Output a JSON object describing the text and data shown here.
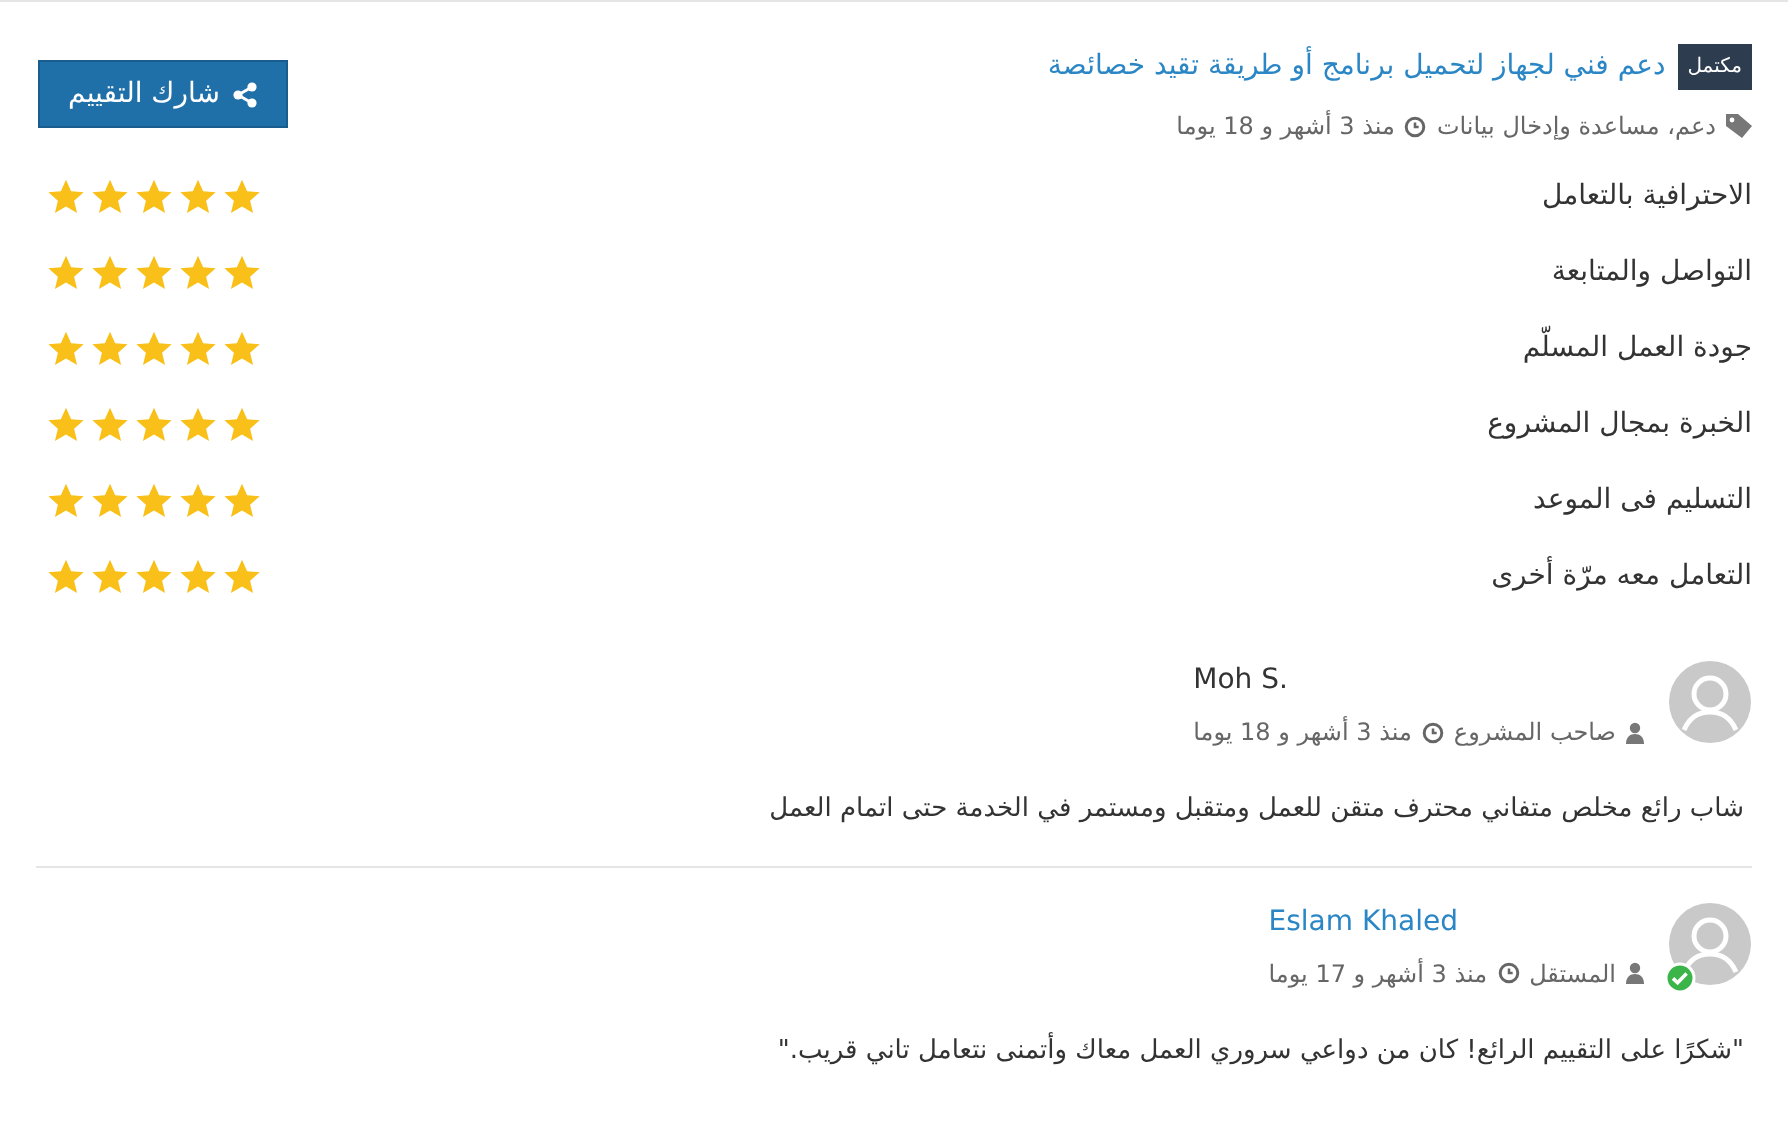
{
  "project": {
    "status_badge": "مكتمل",
    "title": "دعم فني لجهاز لتحميل برنامج أو طريقة تقيد خصائصة",
    "tags": "دعم، مساعدة وإدخال بيانات",
    "time": "منذ 3 أشهر و 18 يوما"
  },
  "share_button": "شارك التقييم",
  "ratings": [
    {
      "label": "الاحترافية بالتعامل",
      "stars": 5
    },
    {
      "label": "التواصل والمتابعة",
      "stars": 5
    },
    {
      "label": "جودة العمل المسلّم",
      "stars": 5
    },
    {
      "label": "الخبرة بمجال المشروع",
      "stars": 5
    },
    {
      "label": "التسليم فى الموعد",
      "stars": 5
    },
    {
      "label": "التعامل معه مرّة أخرى",
      "stars": 5
    }
  ],
  "comments": [
    {
      "name": "Moh S.",
      "role": "صاحب المشروع",
      "time": "منذ 3 أشهر و 18 يوما",
      "text": "شاب رائع مخلص متفاني محترف متقن للعمل ومتقبل ومستمر في الخدمة حتى اتمام العمل",
      "verified": false,
      "link": false
    },
    {
      "name": "Eslam Khaled",
      "role": "المستقل",
      "time": "منذ 3 أشهر و 17 يوما",
      "text": "\"شكرًا على التقييم الرائع! كان من دواعي سروري العمل معاك وأتمنى نتعامل تاني قريب.\"",
      "verified": true,
      "link": true
    }
  ]
}
